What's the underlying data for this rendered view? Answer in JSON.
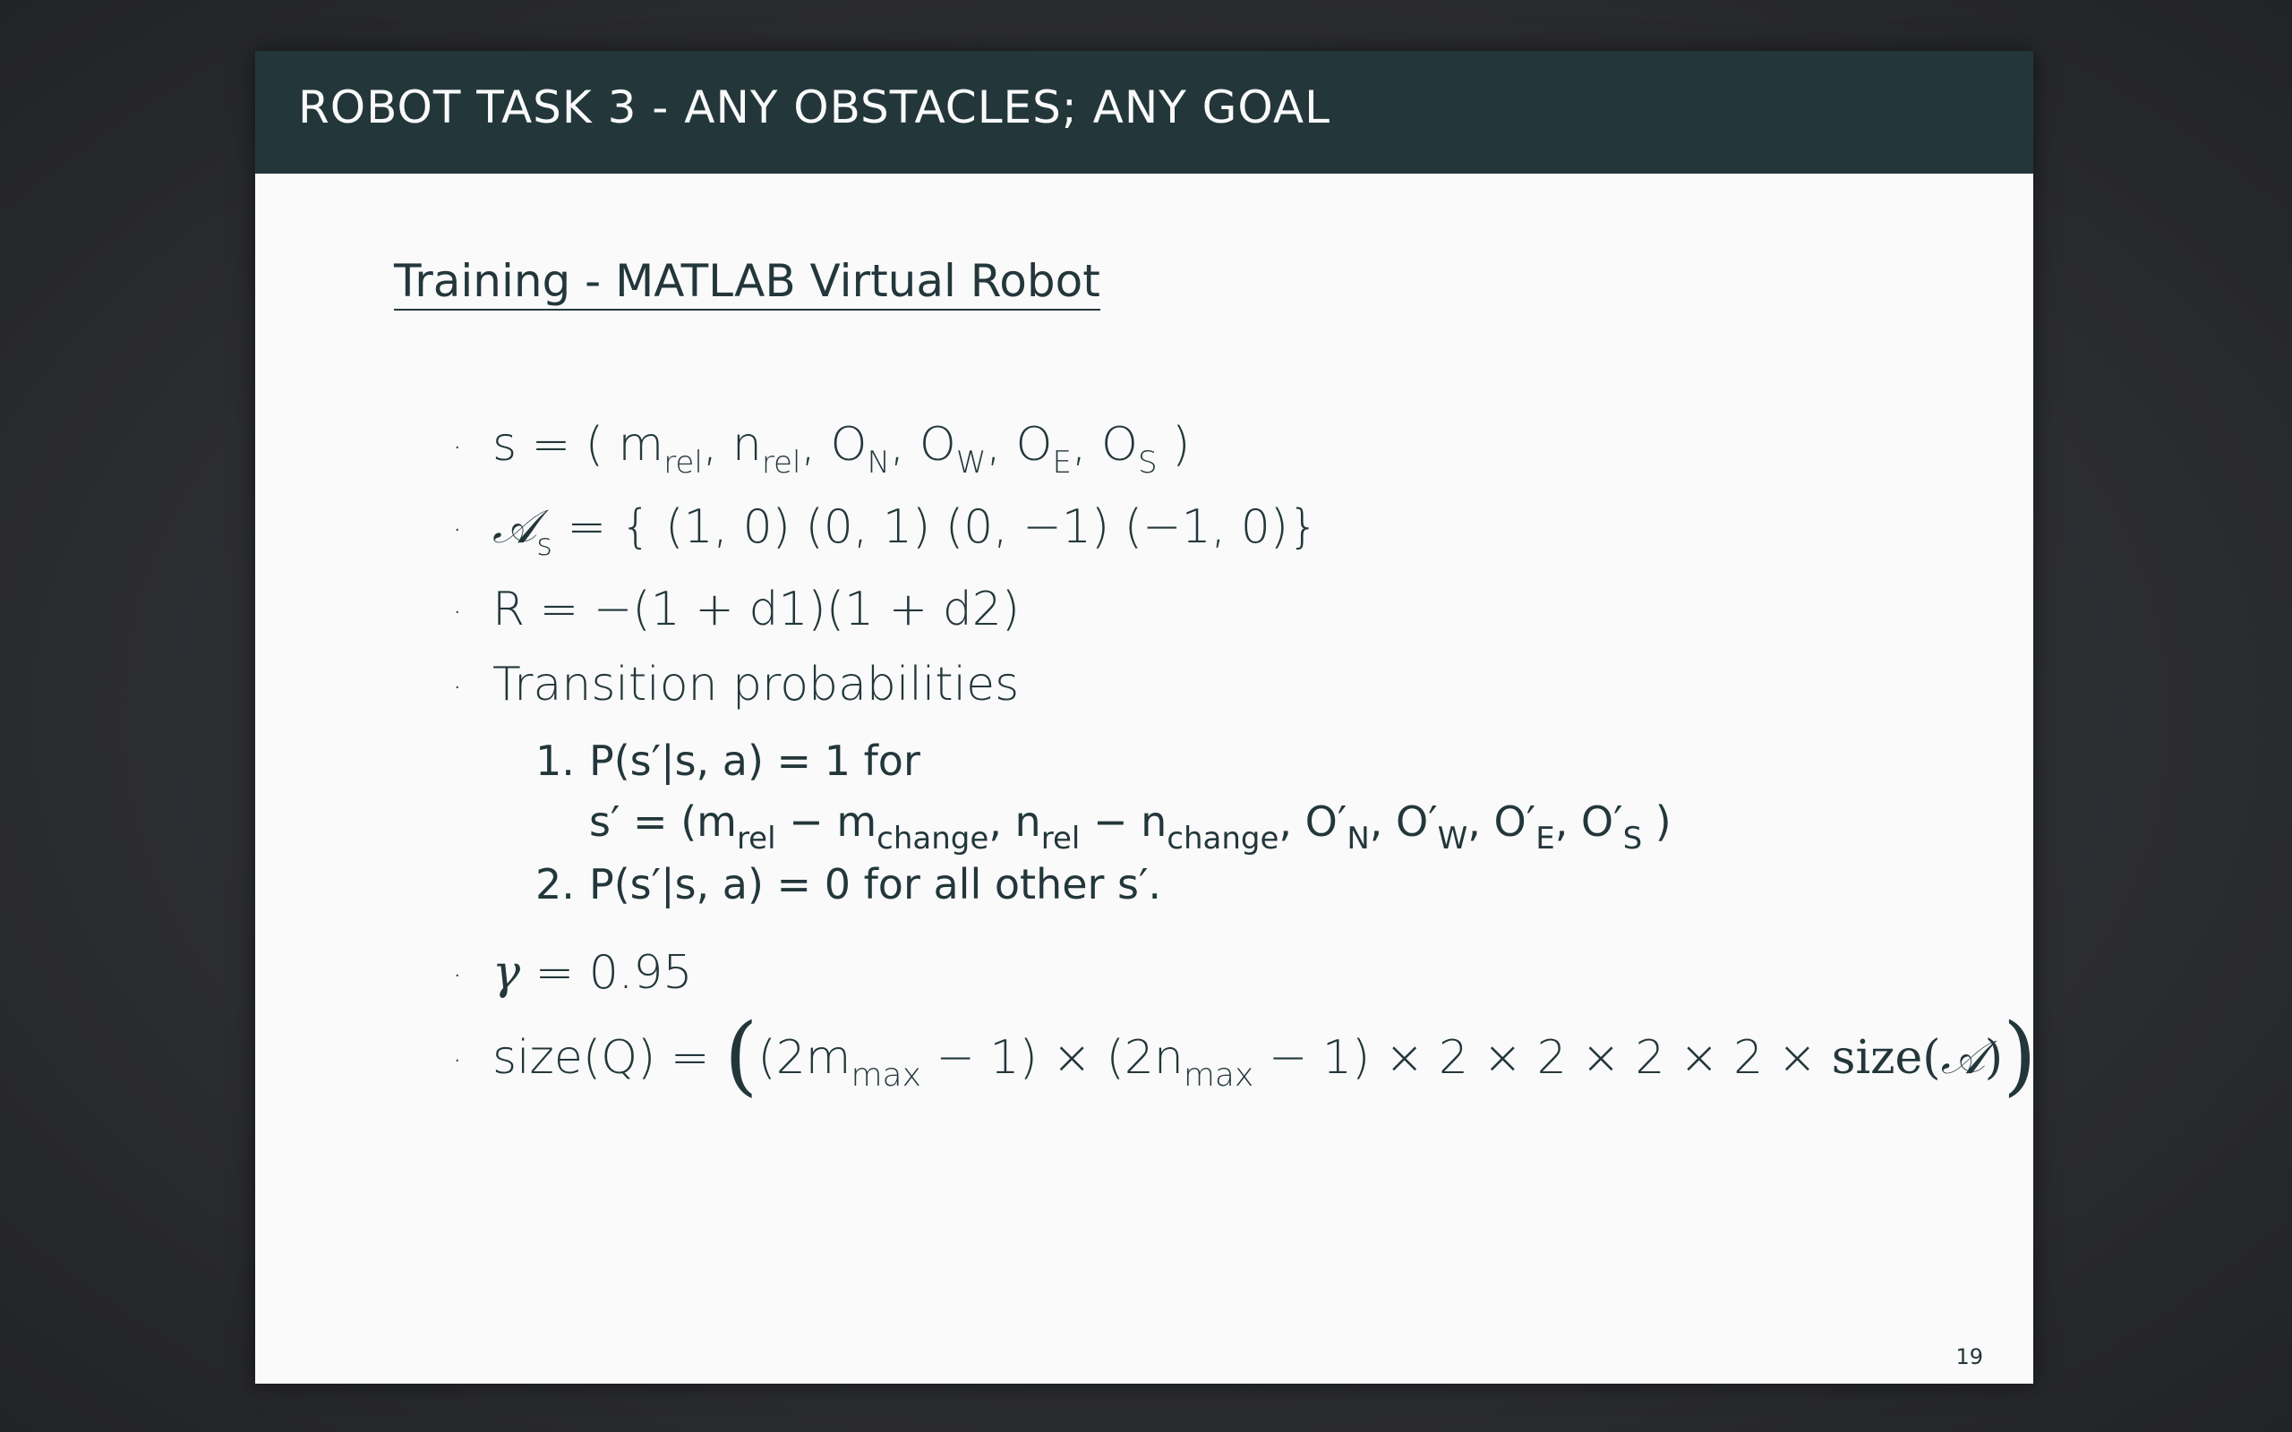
{
  "slide": {
    "title": "ROBOT TASK 3 - ANY OBSTACLES; ANY GOAL",
    "section_heading": "Training - MATLAB Virtual Robot",
    "page_number": "19",
    "bullet_symbol": "·",
    "items": {
      "state": {
        "lhs": "s  =  ( m",
        "sub1": "rel",
        "t2": ",  n",
        "sub2": "rel",
        "t3": ",  O",
        "sub3": "N",
        "t4": ",  O",
        "sub4": "W",
        "t5": ",  O",
        "sub5": "E",
        "t6": ",  O",
        "sub6": "S",
        "t7": " )"
      },
      "actions": {
        "symbol": "𝒜",
        "sub": "s",
        "rest": " = { (1, 0) (0, 1) (0, −1) (−1, 0)}"
      },
      "reward": "R =   −(1  +  d1)(1  +  d2)",
      "transition_label": "Transition probabilities",
      "transitions": [
        {
          "num": "1.",
          "line1": "P(s′|s, a) = 1   for",
          "line2": {
            "a": "s′ = (m",
            "s1": "rel",
            "b": " − m",
            "s2": "change",
            "c": ", n",
            "s3": "rel",
            "d": " − n",
            "s4": "change",
            "e": ",  O′",
            "s5": "N",
            "f": ",  O′",
            "s6": "W",
            "g": ",  O′",
            "s7": "E",
            "h": ",  O′",
            "s8": "S",
            "i": " )"
          }
        },
        {
          "num": "2.",
          "line1": "P(s′|s, a) = 0   for all other s′."
        }
      ],
      "gamma": {
        "symbol": "γ",
        "rest": "  =  0.95"
      },
      "size": {
        "lhs": "size(Q) = ",
        "open": "(",
        "a": "(2m",
        "s1": "max",
        "b": " − 1) × (2n",
        "s2": "max",
        "c": " − 1) × 2 × 2 × 2 × 2 × ",
        "d": "size(",
        "calA": "𝒜",
        "e": ")",
        "close": ")"
      }
    }
  }
}
